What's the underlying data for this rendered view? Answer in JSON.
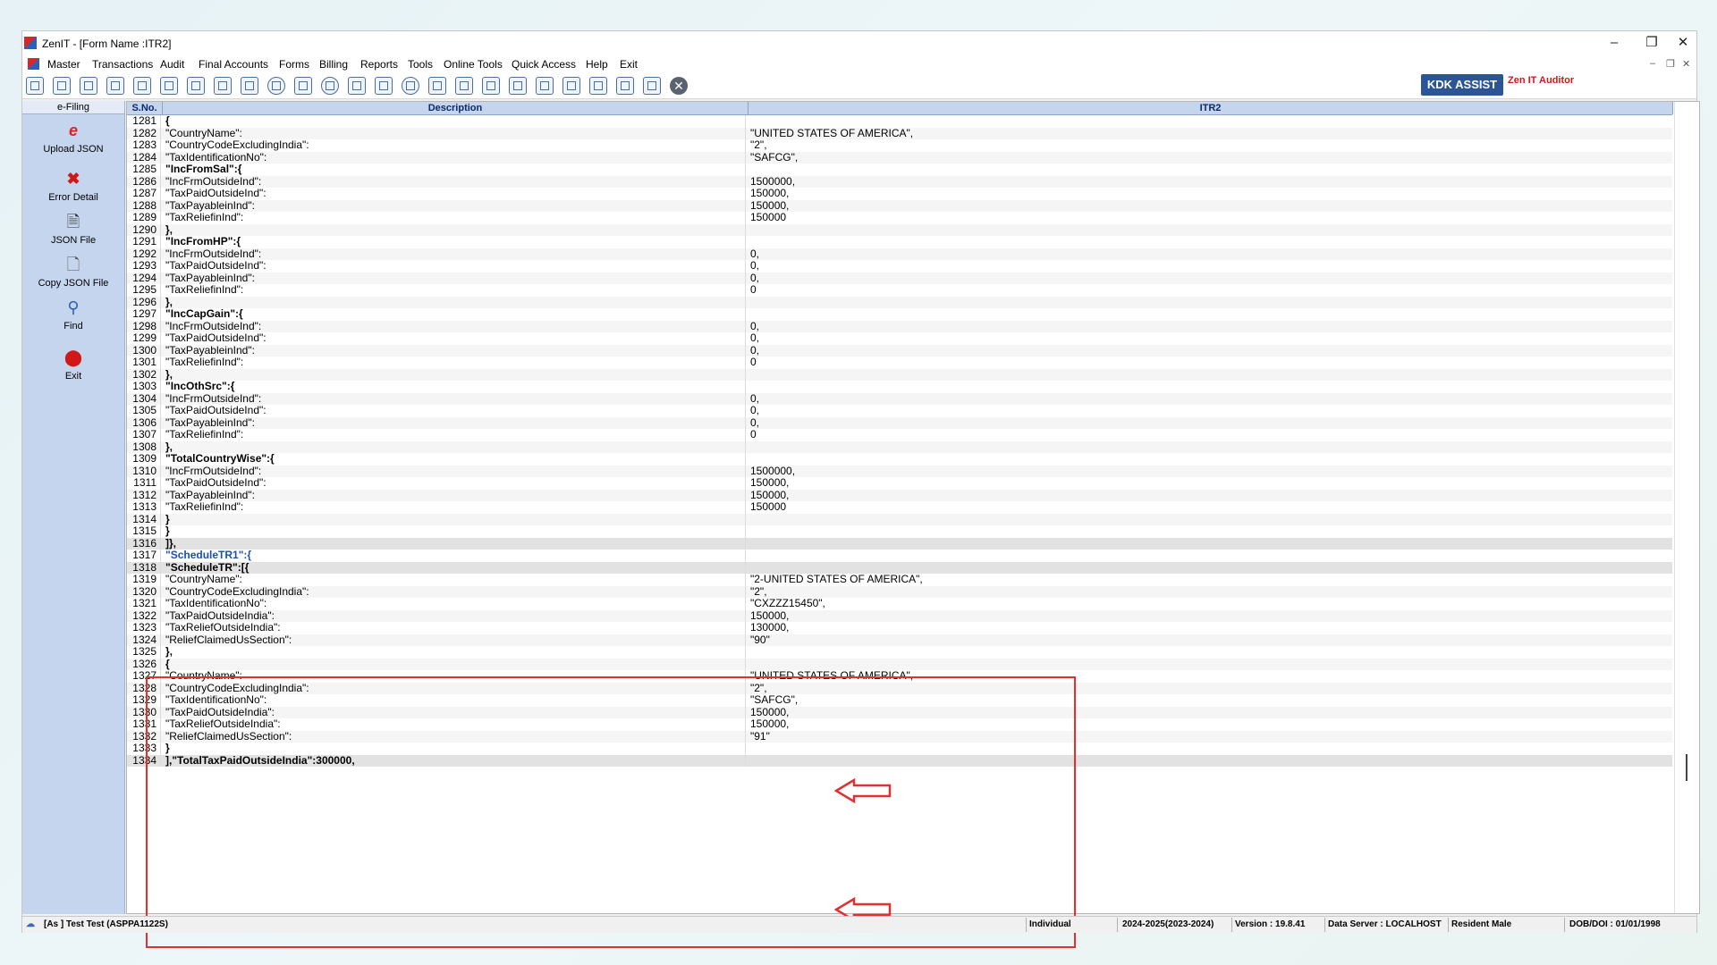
{
  "window": {
    "title": "ZenIT - [Form Name :ITR2]"
  },
  "menu": [
    "Master",
    "Transactions",
    "Audit",
    "Final Accounts",
    "Forms",
    "Billing",
    "Reports",
    "Tools",
    "Online Tools",
    "Quick Access",
    "Help",
    "Exit"
  ],
  "toolbar": {
    "kdk_assist": "KDK ASSIST",
    "zen_auditor": "Zen IT Auditor"
  },
  "sidebar": {
    "header": "e-Filing",
    "items": [
      {
        "label": "Upload JSON",
        "icon": "upload-json-icon"
      },
      {
        "label": "Error Detail",
        "icon": "error-x-icon"
      },
      {
        "label": "JSON File",
        "icon": "json-file-icon"
      },
      {
        "label": "Copy JSON File",
        "icon": "copy-file-icon"
      },
      {
        "label": "Find",
        "icon": "find-icon"
      },
      {
        "label": "Exit",
        "icon": "exit-icon"
      }
    ]
  },
  "grid": {
    "columns": [
      "S.No.",
      "Description",
      "ITR2"
    ],
    "rows": [
      {
        "sno": "1281",
        "desc": "{",
        "val": "",
        "style": "bold"
      },
      {
        "sno": "1282",
        "desc": "\"CountryName\":",
        "val": "\"UNITED STATES OF AMERICA\","
      },
      {
        "sno": "1283",
        "desc": "\"CountryCodeExcludingIndia\":",
        "val": "\"2\","
      },
      {
        "sno": "1284",
        "desc": "\"TaxIdentificationNo\":",
        "val": "\"SAFCG\","
      },
      {
        "sno": "1285",
        "desc": "\"IncFromSal\":{",
        "val": "",
        "style": "bold"
      },
      {
        "sno": "1286",
        "desc": "\"IncFrmOutsideInd\":",
        "val": "1500000,"
      },
      {
        "sno": "1287",
        "desc": "\"TaxPaidOutsideInd\":",
        "val": "150000,"
      },
      {
        "sno": "1288",
        "desc": "\"TaxPayableinInd\":",
        "val": "150000,"
      },
      {
        "sno": "1289",
        "desc": "\"TaxReliefinInd\":",
        "val": "150000"
      },
      {
        "sno": "1290",
        "desc": "},",
        "val": "",
        "style": "bold"
      },
      {
        "sno": "1291",
        "desc": "\"IncFromHP\":{",
        "val": "",
        "style": "bold"
      },
      {
        "sno": "1292",
        "desc": "\"IncFrmOutsideInd\":",
        "val": "0,"
      },
      {
        "sno": "1293",
        "desc": "\"TaxPaidOutsideInd\":",
        "val": "0,"
      },
      {
        "sno": "1294",
        "desc": "\"TaxPayableinInd\":",
        "val": "0,"
      },
      {
        "sno": "1295",
        "desc": "\"TaxReliefinInd\":",
        "val": "0"
      },
      {
        "sno": "1296",
        "desc": "},",
        "val": "",
        "style": "bold"
      },
      {
        "sno": "1297",
        "desc": "\"IncCapGain\":{",
        "val": "",
        "style": "bold"
      },
      {
        "sno": "1298",
        "desc": "\"IncFrmOutsideInd\":",
        "val": "0,"
      },
      {
        "sno": "1299",
        "desc": "\"TaxPaidOutsideInd\":",
        "val": "0,"
      },
      {
        "sno": "1300",
        "desc": "\"TaxPayableinInd\":",
        "val": "0,"
      },
      {
        "sno": "1301",
        "desc": "\"TaxReliefinInd\":",
        "val": "0"
      },
      {
        "sno": "1302",
        "desc": "},",
        "val": "",
        "style": "bold"
      },
      {
        "sno": "1303",
        "desc": "\"IncOthSrc\":{",
        "val": "",
        "style": "bold"
      },
      {
        "sno": "1304",
        "desc": "\"IncFrmOutsideInd\":",
        "val": "0,"
      },
      {
        "sno": "1305",
        "desc": "\"TaxPaidOutsideInd\":",
        "val": "0,"
      },
      {
        "sno": "1306",
        "desc": "\"TaxPayableinInd\":",
        "val": "0,"
      },
      {
        "sno": "1307",
        "desc": "\"TaxReliefinInd\":",
        "val": "0"
      },
      {
        "sno": "1308",
        "desc": "},",
        "val": "",
        "style": "bold"
      },
      {
        "sno": "1309",
        "desc": "\"TotalCountryWise\":{",
        "val": "",
        "style": "bold"
      },
      {
        "sno": "1310",
        "desc": "\"IncFrmOutsideInd\":",
        "val": "1500000,"
      },
      {
        "sno": "1311",
        "desc": "\"TaxPaidOutsideInd\":",
        "val": "150000,"
      },
      {
        "sno": "1312",
        "desc": "\"TaxPayableinInd\":",
        "val": "150000,"
      },
      {
        "sno": "1313",
        "desc": "\"TaxReliefinInd\":",
        "val": "150000"
      },
      {
        "sno": "1314",
        "desc": "}",
        "val": "",
        "style": "bold"
      },
      {
        "sno": "1315",
        "desc": "}",
        "val": "",
        "style": "bold"
      },
      {
        "sno": "1316",
        "desc": "]},",
        "val": "",
        "style": "bold",
        "hl": true
      },
      {
        "sno": "1317",
        "desc": "\"ScheduleTR1\":{",
        "val": "",
        "style": "blue"
      },
      {
        "sno": "1318",
        "desc": "\"ScheduleTR\":[{",
        "val": "",
        "style": "bold",
        "hl": true
      },
      {
        "sno": "1319",
        "desc": "\"CountryName\":",
        "val": "\"2-UNITED STATES OF AMERICA\","
      },
      {
        "sno": "1320",
        "desc": "\"CountryCodeExcludingIndia\":",
        "val": "\"2\","
      },
      {
        "sno": "1321",
        "desc": "\"TaxIdentificationNo\":",
        "val": "\"CXZZZ15450\","
      },
      {
        "sno": "1322",
        "desc": "\"TaxPaidOutsideIndia\":",
        "val": "150000,"
      },
      {
        "sno": "1323",
        "desc": "\"TaxReliefOutsideIndia\":",
        "val": "130000,"
      },
      {
        "sno": "1324",
        "desc": "\"ReliefClaimedUsSection\":",
        "val": "\"90\""
      },
      {
        "sno": "1325",
        "desc": "},",
        "val": "",
        "style": "bold"
      },
      {
        "sno": "1326",
        "desc": "{",
        "val": "",
        "style": "bold"
      },
      {
        "sno": "1327",
        "desc": "\"CountryName\":",
        "val": "\"UNITED STATES OF AMERICA\","
      },
      {
        "sno": "1328",
        "desc": "\"CountryCodeExcludingIndia\":",
        "val": "\"2\","
      },
      {
        "sno": "1329",
        "desc": "\"TaxIdentificationNo\":",
        "val": "\"SAFCG\","
      },
      {
        "sno": "1330",
        "desc": "\"TaxPaidOutsideIndia\":",
        "val": "150000,"
      },
      {
        "sno": "1331",
        "desc": "\"TaxReliefOutsideIndia\":",
        "val": "150000,"
      },
      {
        "sno": "1332",
        "desc": "\"ReliefClaimedUsSection\":",
        "val": "\"91\""
      },
      {
        "sno": "1333",
        "desc": "}",
        "val": "",
        "style": "bold"
      },
      {
        "sno": "1334",
        "desc": "],\"TotalTaxPaidOutsideIndia\":300000,",
        "val": "",
        "style": "bold",
        "hl": true
      }
    ]
  },
  "statusbar": {
    "user": "[As ] Test Test (ASPPA1122S)",
    "status": "Individual",
    "assessment_year": "2024-2025(2023-2024)",
    "version": "Version : 19.8.41",
    "data_server": "Data Server : LOCALHOST",
    "residency": "Resident Male",
    "dob": "DOB/DOI : 01/01/1998"
  },
  "colors": {
    "accent": "#2b5597",
    "highlight_box": "#e03030",
    "sidebar_bg": "#c6d5ee"
  }
}
